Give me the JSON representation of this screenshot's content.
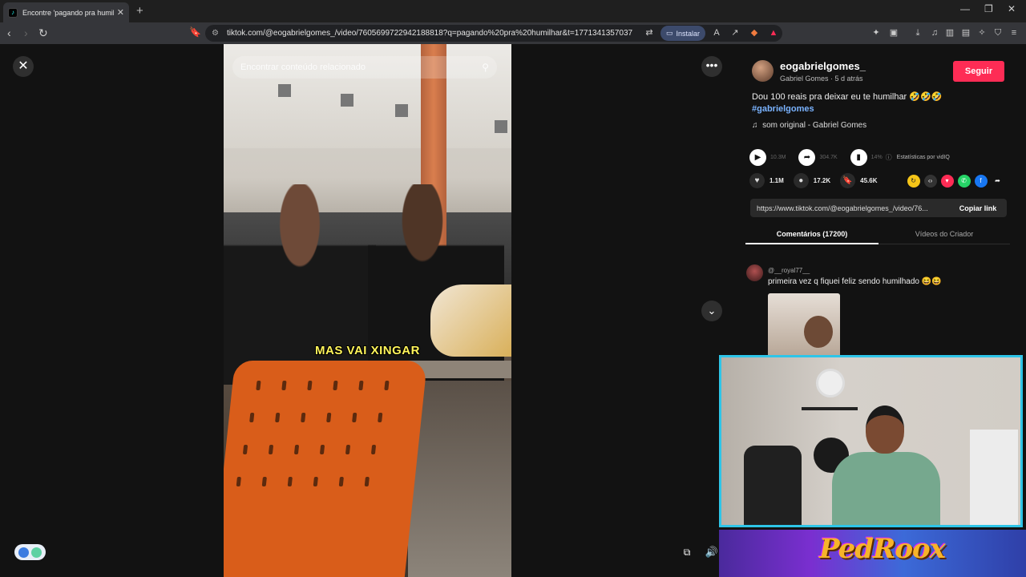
{
  "browser": {
    "tab_title": "Encontre 'pagando pra humil",
    "tab_favicon": "tiktok-icon",
    "url": "tiktok.com/@eogabrielgomes_/video/7605699722942188818?q=pagando%20pra%20humilhar&t=1771341357037",
    "install_label": "Instalar",
    "new_tab": "+",
    "window_controls": [
      "—",
      "❐",
      "✕"
    ]
  },
  "viewer": {
    "search_placeholder": "Encontrar conteúdo relacionado",
    "caption": "MAS VAI XINGAR"
  },
  "post": {
    "username": "eogabrielgomes_",
    "display_name": "Gabriel Gomes",
    "posted_ago": "5 d atrás",
    "follow_label": "Seguir",
    "description": "Dou 100 reais pra deixar eu te humilhar 🤣🤣🤣",
    "hashtag": "#gabrielgomes",
    "music": "som original - Gabriel Gomes",
    "views": "10.3M",
    "shares_stat": "304.7K",
    "engagement_pct": "14%",
    "vidiq_label": "Estatísticas por vidIQ",
    "likes": "1.1M",
    "comments_count": "17.2K",
    "saves": "45.6K",
    "share_link": "https://www.tiktok.com/@eogabrielgomes_/video/76...",
    "copy_link_label": "Copiar link"
  },
  "tabs": {
    "comments": "Comentários (17200)",
    "creator_videos": "Vídeos do Criador"
  },
  "comment": {
    "user": "@__royal77__",
    "text": "primeira vez q fiquei feliz sendo humilhado 😆😆"
  },
  "overlay": {
    "logo_text": "PedRoox"
  },
  "colors": {
    "follow": "#fe2c55",
    "webcam_border": "#2ec5e8",
    "hashtag": "#7ab3ff",
    "caption": "#fff45a"
  }
}
